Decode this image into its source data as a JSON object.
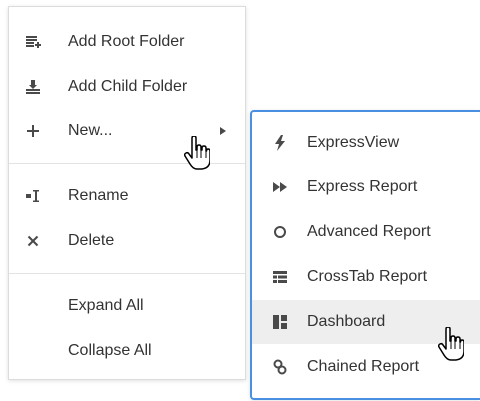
{
  "context_menu": {
    "items": [
      {
        "label": "Add Root Folder",
        "icon": "add-root-folder-icon"
      },
      {
        "label": "Add Child Folder",
        "icon": "add-child-folder-icon"
      },
      {
        "label": "New...",
        "icon": "plus-icon",
        "has_submenu": true
      },
      {
        "label": "Rename",
        "icon": "rename-icon"
      },
      {
        "label": "Delete",
        "icon": "close-icon"
      },
      {
        "label": "Expand All"
      },
      {
        "label": "Collapse All"
      }
    ]
  },
  "submenu": {
    "items": [
      {
        "label": "ExpressView",
        "icon": "lightning-icon"
      },
      {
        "label": "Express Report",
        "icon": "fast-forward-icon"
      },
      {
        "label": "Advanced Report",
        "icon": "circle-icon"
      },
      {
        "label": "CrossTab Report",
        "icon": "crosstab-icon"
      },
      {
        "label": "Dashboard",
        "icon": "dashboard-icon",
        "highlighted": true
      },
      {
        "label": "Chained Report",
        "icon": "chain-icon"
      }
    ]
  },
  "colors": {
    "submenu_border": "#4a90e2",
    "highlight_background": "#eeeeee",
    "text": "#333333"
  }
}
